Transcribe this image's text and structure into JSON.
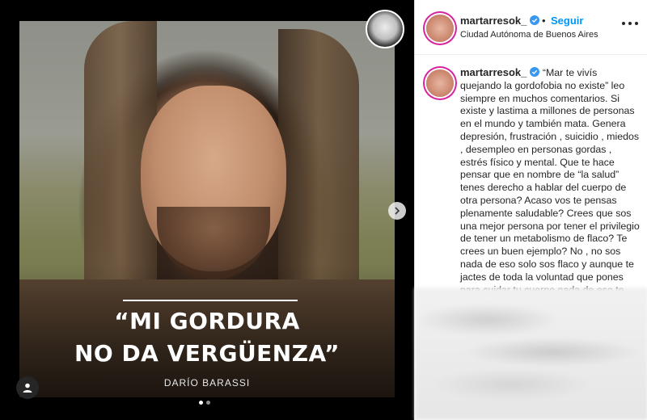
{
  "post": {
    "username": "martarresok_",
    "follow_separator": "•",
    "follow_label": "Seguir",
    "location": "Ciudad Autónoma de Buenos Aires",
    "caption": "“Mar te vivís quejando la gordofobia no existe” leo siempre en muchos comentarios. Si existe y lastima a millones de personas en el mundo y también mata. Genera depresión, frustración , suicidio , miedos , desempleo en personas gordas , estrés físico y mental. Que te hace pensar que en nombre de “la salud” tenes derecho a hablar del cuerpo de otra persona? Acaso vos te pensas plenamente saludable? Crees que sos una mejor persona por tener el privilegio de tener un metabolismo de flaco? Te crees un buen ejemplo? No , no sos nada de eso solo sos flaco y aunque te jactes de toda la voluntad que pones para cuidar tu cuerpo nada de eso te hace mejor"
  },
  "media": {
    "quote_line1": "“MI GORDURA",
    "quote_line2": "NO DA VERGÜENZA”",
    "author": "DARÍO BARASSI",
    "carousel_total": 2,
    "carousel_active": 1
  },
  "colors": {
    "accent": "#0095f6",
    "verified": "#3897f0",
    "story_ring": "#d6249f"
  },
  "icons": {
    "verified": "verified-badge-icon",
    "next": "chevron-right-icon",
    "more": "more-options-icon",
    "user_tag": "user-tag-icon"
  }
}
